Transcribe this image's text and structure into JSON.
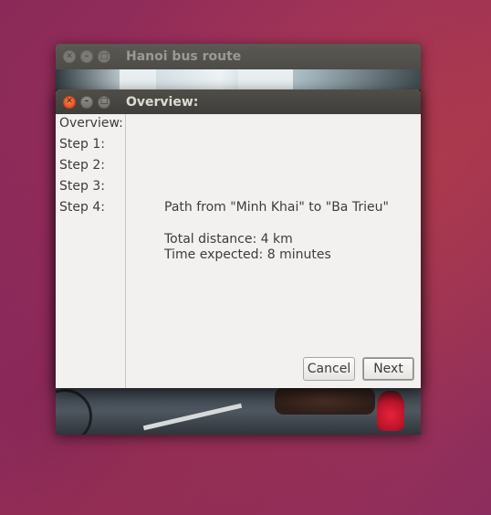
{
  "back_window": {
    "title": "Hanoi bus route"
  },
  "dialog": {
    "title": "Overview:",
    "steps": [
      {
        "label": "Overview:"
      },
      {
        "label": "Step 1:"
      },
      {
        "label": "Step 2:"
      },
      {
        "label": "Step 3:"
      },
      {
        "label": "Step 4:"
      }
    ],
    "path": "Path from \"Minh Khai\" to \"Ba Trieu\"",
    "total_distance": "Total distance: 4 km",
    "time_expected": "Time expected: 8 minutes",
    "cancel_label": "Cancel",
    "next_label": "Next"
  },
  "icons": {
    "close": "close-icon",
    "minimize": "minimize-icon",
    "maximize": "maximize-icon"
  },
  "colors": {
    "desktop": "#922e5a",
    "titlebar": "#45443f",
    "close_button": "#e8541e",
    "window_bg": "#f2f1f0",
    "text": "#3c3c3c"
  }
}
